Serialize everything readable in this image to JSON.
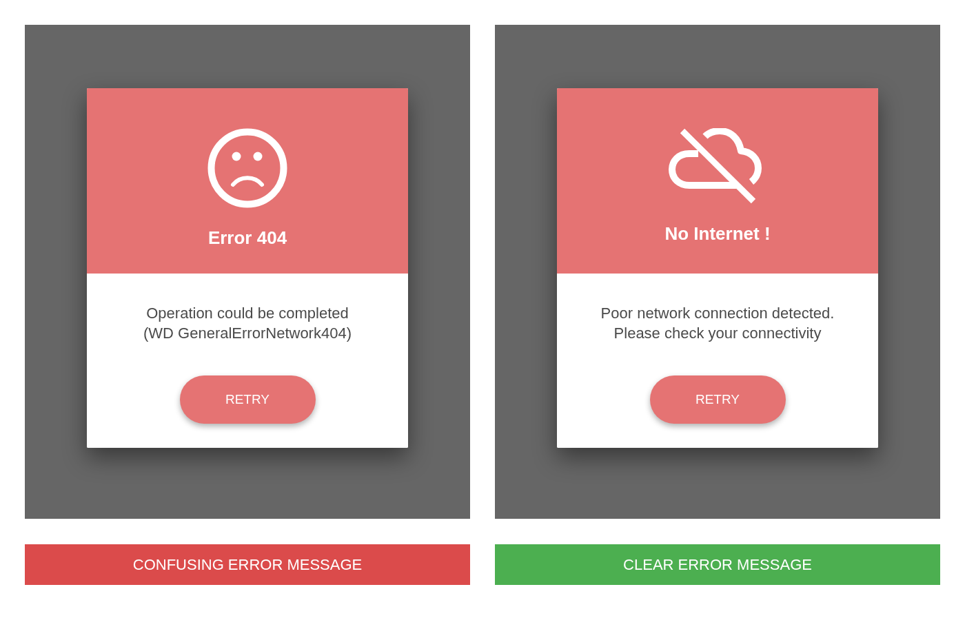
{
  "panels": [
    {
      "icon": {
        "kind": "sad-face"
      },
      "title": "Error 404",
      "message": [
        "Operation could be completed",
        "(WD GeneralErrorNetwork404)"
      ],
      "button": "RETRY",
      "caption": {
        "text": "CONFUSING ERROR MESSAGE",
        "color": "#db4b4b"
      }
    },
    {
      "icon": {
        "kind": "cloud-off"
      },
      "title": "No Internet !",
      "message": [
        "Poor network connection detected.",
        "Please check your connectivity"
      ],
      "button": "RETRY",
      "caption": {
        "text": "CLEAR ERROR MESSAGE",
        "color": "#4caf50"
      }
    }
  ]
}
